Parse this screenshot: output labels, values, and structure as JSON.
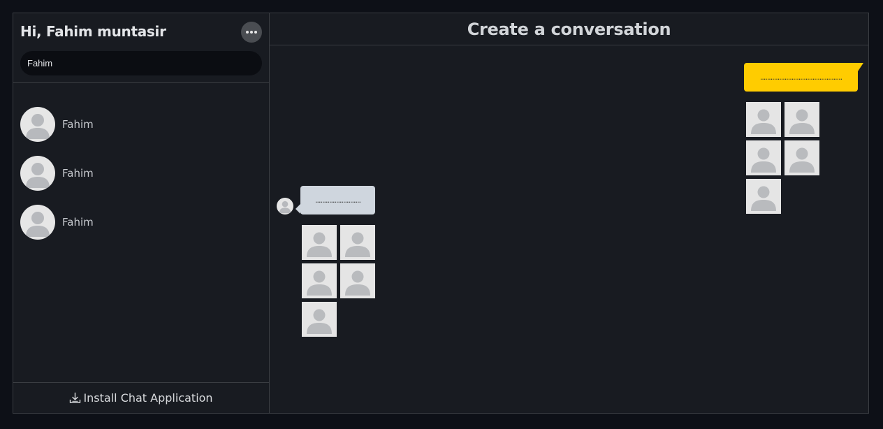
{
  "sidebar": {
    "greeting": "Hi, Fahim muntasir",
    "more_icon": "more-horizontal-icon",
    "search": {
      "value": "Fahim",
      "placeholder": ""
    },
    "contacts": [
      {
        "name": "Fahim",
        "avatar": "user-placeholder"
      },
      {
        "name": "Fahim",
        "avatar": "user-placeholder"
      },
      {
        "name": "Fahim",
        "avatar": "user-placeholder"
      }
    ],
    "install_label": "Install Chat Application",
    "install_icon": "download-icon"
  },
  "main": {
    "title": "Create a conversation",
    "messages": [
      {
        "direction": "outgoing",
        "text": "...............................................",
        "images": 5,
        "color": "#ffcc00"
      },
      {
        "direction": "incoming",
        "text": "..........................",
        "images": 5,
        "color": "#cfd6de"
      }
    ]
  },
  "colors": {
    "background": "#0d1017",
    "panel": "#181b21",
    "border": "#3a3d42",
    "accent": "#ffcc00",
    "incoming_bubble": "#cfd6de"
  }
}
